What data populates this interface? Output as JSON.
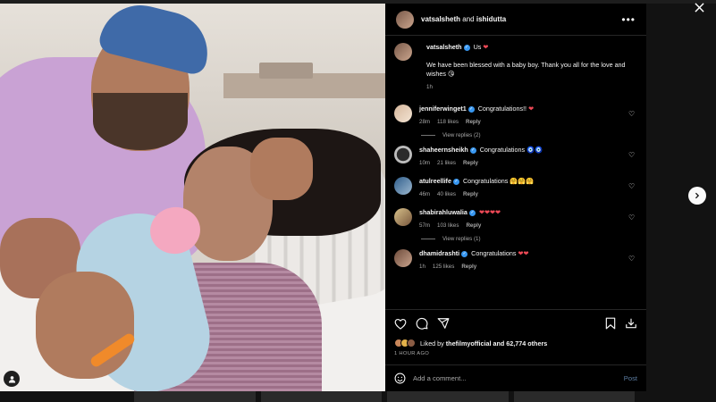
{
  "post": {
    "header": {
      "user1": "vatsalsheth",
      "joiner": "and",
      "user2": "ishidutta"
    },
    "caption": {
      "username": "vatsalsheth",
      "title_text": "Us",
      "title_emoji": "❤",
      "body_text": "We have been blessed with a baby boy. Thank you all for the love and wishes",
      "body_emoji": "😘",
      "time": "1h"
    },
    "comments": [
      {
        "username": "jenniferwinget1",
        "text": "Congratulations!!",
        "emoji": "❤",
        "time": "28m",
        "likes": "118 likes",
        "reply": "Reply",
        "view_replies": "View replies (2)"
      },
      {
        "username": "shaheernsheikh",
        "text": "Congratulations",
        "emoji": "🧿🧿",
        "time": "10m",
        "likes": "21 likes",
        "reply": "Reply"
      },
      {
        "username": "atulreellife",
        "text": "Congratulations",
        "emoji": "🤗🤗🤗",
        "time": "46m",
        "likes": "40 likes",
        "reply": "Reply"
      },
      {
        "username": "shabirahluwalia",
        "text": "",
        "emoji": "❤❤❤❤",
        "time": "57m",
        "likes": "103 likes",
        "reply": "Reply",
        "view_replies": "View replies (1)"
      },
      {
        "username": "dhamidrashti",
        "text": "Congratulations",
        "emoji": "❤❤",
        "time": "1h",
        "likes": "125 likes",
        "reply": "Reply"
      }
    ],
    "likes": {
      "prefix": "Liked by",
      "user": "thefilmyofficial",
      "suffix": "and 62,774 others"
    },
    "posted_ago": "1 HOUR AGO",
    "add_comment": {
      "placeholder": "Add a comment...",
      "post_label": "Post"
    }
  },
  "icons": {
    "close": "close-icon",
    "next": "chevron-right-icon",
    "more": "more-horizontal-icon",
    "like": "heart-icon",
    "comment": "comment-icon",
    "share": "send-icon",
    "save": "bookmark-icon",
    "download": "download-icon",
    "emoji": "emoji-icon",
    "tag": "user-tag-icon"
  },
  "colors": {
    "background": "#000000",
    "verified": "#3897f0",
    "heart": "#ed4956",
    "post_button": "#5d7ea3"
  }
}
